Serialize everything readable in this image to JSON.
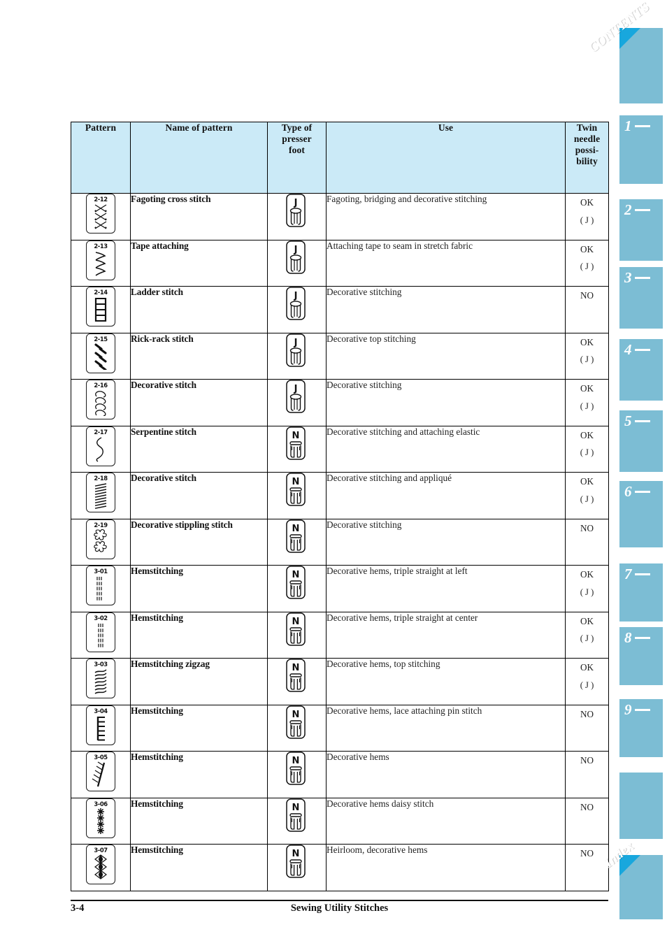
{
  "document": {
    "page_number": "3-4",
    "footer_title": "Sewing Utility Stitches"
  },
  "table": {
    "headers": {
      "pattern": "Pattern",
      "name": "Name of pattern",
      "presser_foot": "Type of\npresser\nfoot",
      "presser_foot_l1": "Type of",
      "presser_foot_l2": "presser",
      "presser_foot_l3": "foot",
      "use": "Use",
      "twin_l1": "Twin",
      "twin_l2": "needle",
      "twin_l3": "possi-",
      "twin_l4": "bility"
    },
    "rows": [
      {
        "code": "2-12",
        "art": "cross-stitch",
        "name": "Fagoting cross stitch",
        "foot": "J",
        "use": "Fagoting, bridging and decorative stitching",
        "twin": "OK",
        "twin_sub": "( J )"
      },
      {
        "code": "2-13",
        "art": "tape-zigzag",
        "name": "Tape attaching",
        "foot": "J",
        "use": "Attaching tape to seam in stretch fabric",
        "twin": "OK",
        "twin_sub": "( J )"
      },
      {
        "code": "2-14",
        "art": "ladder",
        "name": "Ladder stitch",
        "foot": "J",
        "use": "Decorative stitching",
        "twin": "NO",
        "twin_sub": ""
      },
      {
        "code": "2-15",
        "art": "rick-rack",
        "name": "Rick-rack stitch",
        "foot": "J",
        "use": "Decorative top stitching",
        "twin": "OK",
        "twin_sub": "( J )"
      },
      {
        "code": "2-16",
        "art": "decorative-loops",
        "name": "Decorative stitch",
        "foot": "J",
        "use": "Decorative stitching",
        "twin": "OK",
        "twin_sub": "( J )"
      },
      {
        "code": "2-17",
        "art": "serpentine",
        "name": "Serpentine stitch",
        "foot": "N",
        "use": "Decorative stitching and attaching elastic",
        "twin": "OK",
        "twin_sub": "( J )"
      },
      {
        "code": "2-18",
        "art": "dense-zigzag",
        "name": "Decorative stitch",
        "foot": "N",
        "use": "Decorative stitching and appliqué",
        "twin": "OK",
        "twin_sub": "( J )"
      },
      {
        "code": "2-19",
        "art": "stippling",
        "name": "Decorative stippling stitch",
        "foot": "N",
        "use": "Decorative stitching",
        "twin": "NO",
        "twin_sub": ""
      },
      {
        "code": "3-01",
        "art": "triple-left",
        "name": "Hemstitching",
        "foot": "N",
        "use": "Decorative hems, triple straight at left",
        "twin": "OK",
        "twin_sub": "( J )"
      },
      {
        "code": "3-02",
        "art": "triple-center",
        "name": "Hemstitching",
        "foot": "N",
        "use": "Decorative hems, triple straight at center",
        "twin": "OK",
        "twin_sub": "( J )"
      },
      {
        "code": "3-03",
        "art": "hem-zigzag",
        "name": "Hemstitching zigzag",
        "foot": "N",
        "use": "Decorative hems, top stitching",
        "twin": "OK",
        "twin_sub": "( J )"
      },
      {
        "code": "3-04",
        "art": "comb",
        "name": "Hemstitching",
        "foot": "N",
        "use": "Decorative hems, lace attaching pin stitch",
        "twin": "NO",
        "twin_sub": ""
      },
      {
        "code": "3-05",
        "art": "feather",
        "name": "Hemstitching",
        "foot": "N",
        "use": "Decorative hems",
        "twin": "NO",
        "twin_sub": ""
      },
      {
        "code": "3-06",
        "art": "daisy",
        "name": "Hemstitching",
        "foot": "N",
        "use": "Decorative hems daisy stitch",
        "twin": "NO",
        "twin_sub": ""
      },
      {
        "code": "3-07",
        "art": "diamond-eye",
        "name": "Hemstitching",
        "foot": "N",
        "use": "Heirloom, decorative hems",
        "twin": "NO",
        "twin_sub": ""
      }
    ]
  },
  "sidebar": {
    "accent_color": "#7cbdd4",
    "corner_color": "#18a7dd",
    "shadow_color": "#b9bcbd",
    "tabs": [
      {
        "kind": "label",
        "label": "CONTENTS",
        "icon": "contents-corner-icon"
      },
      {
        "kind": "number",
        "label": "1",
        "icon": "sewing-machine-needle-icon"
      },
      {
        "kind": "number",
        "label": "2",
        "icon": "thread-spool-bobbin-icon"
      },
      {
        "kind": "number",
        "label": "3",
        "icon": "tshirt-stitch-icon"
      },
      {
        "kind": "number",
        "label": "4",
        "icon": "tshirt-abc-icon"
      },
      {
        "kind": "number",
        "label": "5",
        "icon": "embroidery-card-star-icon"
      },
      {
        "kind": "number",
        "label": "6",
        "icon": "tshirt-edit-icon"
      },
      {
        "kind": "number",
        "label": "7",
        "icon": "tshirt-tools-icon"
      },
      {
        "kind": "number",
        "label": "8",
        "icon": "machine-sparkle-icon"
      },
      {
        "kind": "number",
        "label": "9",
        "icon": "machine-question-icon"
      },
      {
        "kind": "plain",
        "label": "",
        "icon": "pages-stack-icon"
      },
      {
        "kind": "label",
        "label": "Index",
        "icon": "index-corner-icon"
      }
    ]
  }
}
